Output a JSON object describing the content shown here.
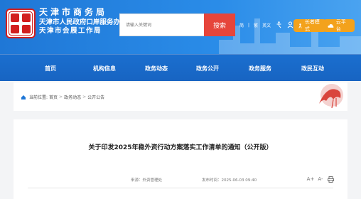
{
  "header": {
    "title": "天津市商务局",
    "subtitle1": "天津市人民政府口岸服务办公室",
    "subtitle2": "天津市会展工作局",
    "brand_color": "#1f77d6",
    "seal_icon": "seal-logo"
  },
  "search": {
    "placeholder": "请输入关键词",
    "button_label": "搜索"
  },
  "tools": {
    "simplified": "简",
    "separator": "|",
    "traditional": "繁",
    "english": "英文",
    "icons": [
      "accessibility-icon",
      "user-icon",
      "weibo-icon",
      "wechat-icon"
    ]
  },
  "pills": {
    "elder_label": "长者模式",
    "cloud_label": "云平台"
  },
  "nav": {
    "items": [
      "首页",
      "机构信息",
      "政务动态",
      "政务公开",
      "政务服务",
      "政民互动"
    ]
  },
  "breadcrumb": {
    "prefix": "当前位置:",
    "items": [
      "首页",
      "政务动态",
      "公开公告"
    ],
    "sep": ">"
  },
  "article": {
    "title": "关于印发2025年稳外资行动方案落实工作清单的通知（公开版）",
    "source_label": "来源：外资管理处",
    "date_label": "发布时间：2025-06-03 09:40",
    "controls": [
      "A+",
      "A-",
      "print-icon"
    ]
  },
  "colors": {
    "search_button": "#e6453b",
    "pill": "#f3a21c",
    "nav_bg": "#1a6fcf"
  }
}
